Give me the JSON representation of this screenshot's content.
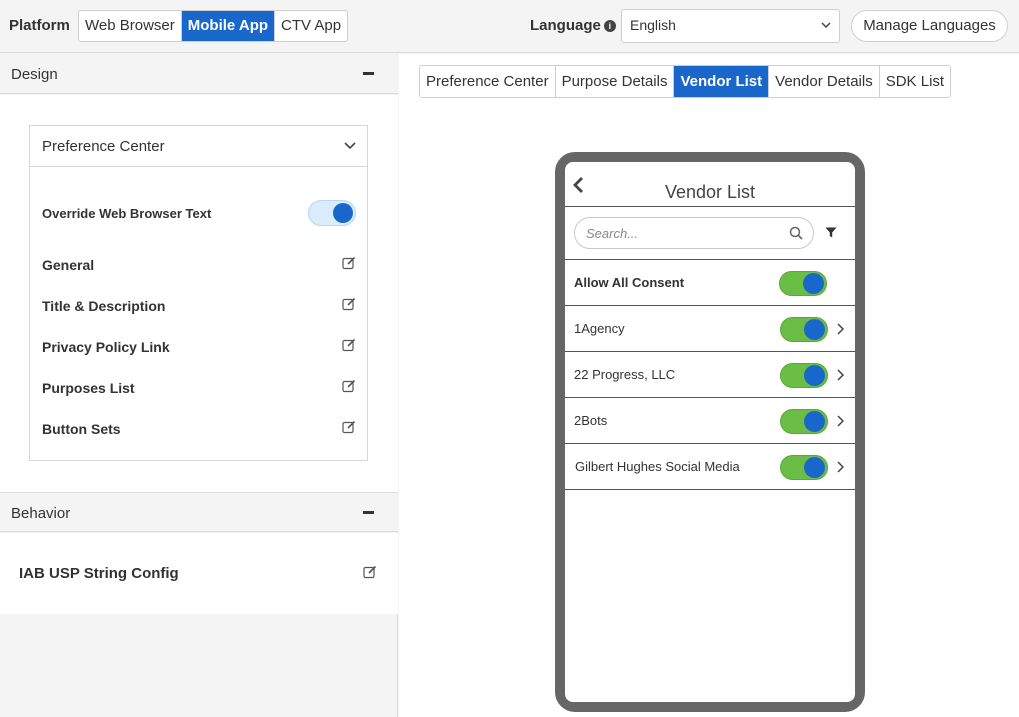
{
  "topbar": {
    "platform_label": "Platform",
    "platform_options": [
      "Web Browser",
      "Mobile App",
      "CTV App"
    ],
    "platform_selected": "Mobile App",
    "language_label": "Language",
    "language_value": "English",
    "manage_languages": "Manage Languages"
  },
  "design": {
    "title": "Design",
    "card_title": "Preference Center",
    "override_label": "Override Web Browser Text",
    "override_on": true,
    "items": [
      "General",
      "Title & Description",
      "Privacy Policy Link",
      "Purposes List",
      "Button Sets"
    ]
  },
  "behavior": {
    "title": "Behavior",
    "item": "IAB USP String Config"
  },
  "tabs": {
    "items": [
      "Preference Center",
      "Purpose Details",
      "Vendor List",
      "Vendor Details",
      "SDK List"
    ],
    "selected": "Vendor List"
  },
  "phone": {
    "title": "Vendor List",
    "search_placeholder": "Search...",
    "allow_all_label": "Allow All Consent",
    "vendors": [
      "1Agency",
      "22 Progress, LLC",
      "2Bots",
      "Gilbert Hughes Social Media"
    ]
  },
  "colors": {
    "accent": "#1a67cc",
    "toggle_green": "#6abd45",
    "phone_frame": "#666666"
  },
  "icons": [
    "info-icon",
    "chevron-down-icon",
    "minus-icon",
    "edit-icon",
    "back-arrow-icon",
    "search-icon",
    "filter-icon",
    "chevron-right-icon"
  ]
}
